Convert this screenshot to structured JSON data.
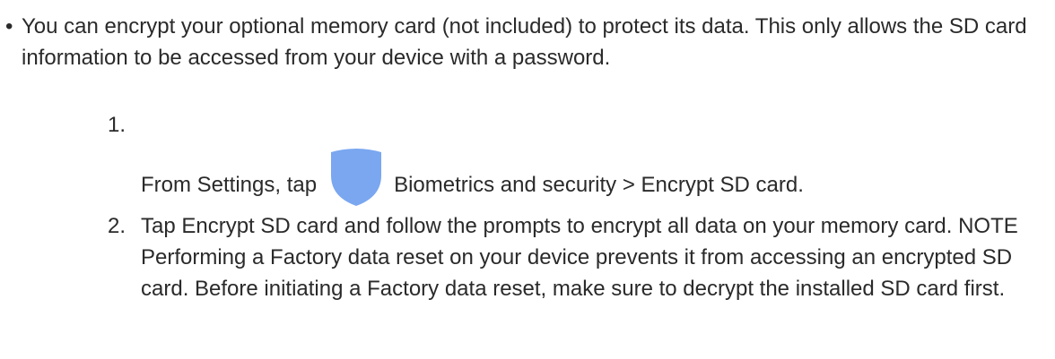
{
  "bullet": {
    "mark": "•",
    "text": "You can encrypt your optional memory card (not included) to protect its data. This only allows the SD card information to be accessed from your device with a password."
  },
  "steps": [
    {
      "number": "1.",
      "text_before_icon": "From Settings, tap",
      "icon": "shield-icon",
      "text_after_icon": "Biometrics and security > Encrypt SD card."
    },
    {
      "number": "2.",
      "text": "Tap Encrypt SD card and follow the prompts to encrypt all data on your memory card. NOTE Performing a Factory data reset on your device prevents it from accessing an encrypted SD card. Before initiating a Factory data reset, make sure to decrypt the installed SD card first."
    }
  ],
  "colors": {
    "text": "#2a2a2a",
    "shield": "#7aa7f0"
  }
}
